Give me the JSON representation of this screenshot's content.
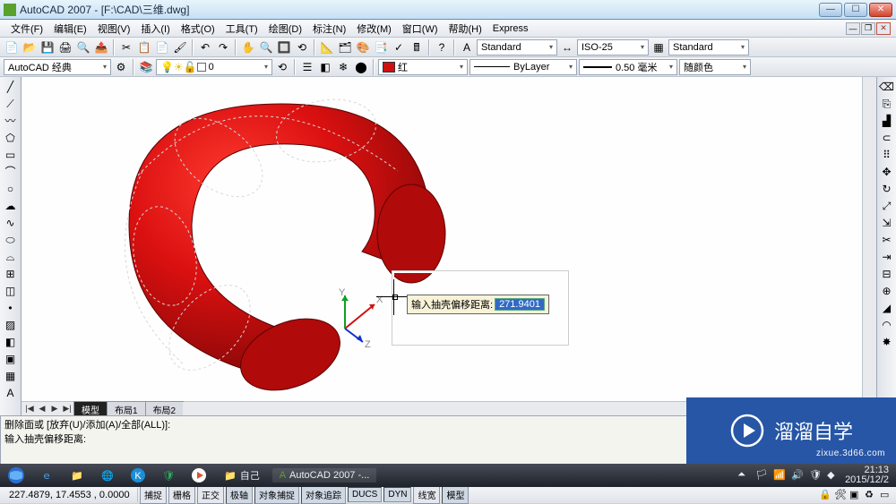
{
  "title": "AutoCAD 2007 - [F:\\CAD\\三维.dwg]",
  "menu": [
    "文件(F)",
    "编辑(E)",
    "视图(V)",
    "插入(I)",
    "格式(O)",
    "工具(T)",
    "绘图(D)",
    "标注(N)",
    "修改(M)",
    "窗口(W)",
    "帮助(H)",
    "Express"
  ],
  "workspace_combo": "AutoCAD 经典",
  "layer_combo": "0",
  "text_style": "Standard",
  "dim_style": "ISO-25",
  "table_style": "Standard",
  "color": {
    "swatch": "#d01010",
    "label": "红"
  },
  "linetype": "ByLayer",
  "lineweight": "0.50 毫米",
  "plotstyle": "随颜色",
  "tabs": {
    "nav": [
      "|◀",
      "◀",
      "▶",
      "▶|"
    ],
    "items": [
      "模型",
      "布局1",
      "布局2"
    ],
    "active": 0
  },
  "cmd": {
    "line1": "删除面或 [放弃(U)/添加(A)/全部(ALL)]:",
    "line2": "输入抽壳偏移距离:"
  },
  "dyn": {
    "prompt": "输入抽壳偏移距离:",
    "value": "271.9401"
  },
  "status": {
    "coords": "227.4879, 17.4553 , 0.0000",
    "toggles": [
      "捕捉",
      "栅格",
      "正交",
      "极轴",
      "对象捕捉",
      "对象追踪",
      "DUCS",
      "DYN",
      "线宽",
      "模型"
    ]
  },
  "taskbar": {
    "tasks": [
      {
        "label": "自己"
      },
      {
        "label": "AutoCAD 2007 -..."
      }
    ],
    "time": "21:13",
    "date": "2015/12/2"
  },
  "watermark": {
    "text": "溜溜自学",
    "url": "zixue.3d66.com"
  },
  "ucs_labels": {
    "x": "X",
    "y": "Y",
    "z": "Z"
  }
}
